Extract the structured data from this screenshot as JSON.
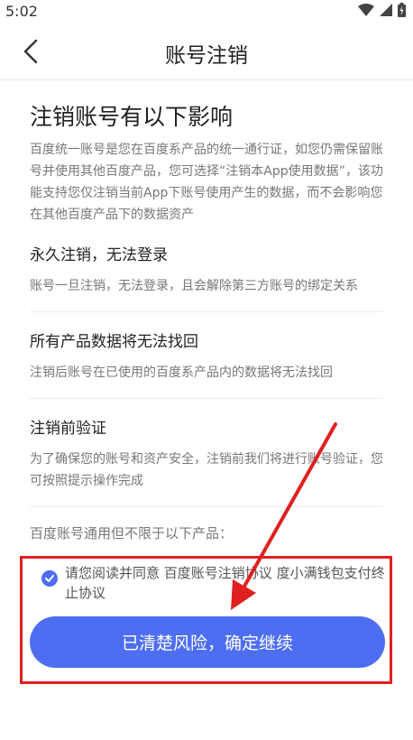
{
  "status_bar": {
    "time": "5:02",
    "icons": [
      "wifi-icon",
      "cellular-signal-icon",
      "battery-icon"
    ]
  },
  "header": {
    "title": "账号注销",
    "back_icon": "chevron-left-icon"
  },
  "main": {
    "heading": "注销账号有以下影响",
    "intro": "百度统一账号是您在百度系产品的统一通行证，如您仍需保留账号并使用其他百度产品，您可选择“注销本App使用数据”，该功能支持您仅注销当前App下账号使用产生的数据，而不会影响您在其他百度产品下的数据资产",
    "sections": [
      {
        "title": "永久注销，无法登录",
        "desc": "账号一旦注销，无法登录，且会解除第三方账号的绑定关系"
      },
      {
        "title": "所有产品数据将无法找回",
        "desc": "注销后账号在已使用的百度系产品内的数据将无法找回"
      },
      {
        "title": "注销前验证",
        "desc": "为了确保您的账号和资产安全，注销前我们将进行账号验证，您可按照提示操作完成"
      }
    ],
    "products_label": "百度账号通用但不限于以下产品："
  },
  "agreement": {
    "checked": true,
    "prefix": "请您阅读并同意 ",
    "link1": "百度账号注销协议",
    "link2": "度小满钱包支付终止协议"
  },
  "confirm_button": {
    "label": "已清楚风险，确定继续"
  },
  "colors": {
    "accent": "#4e6ef2",
    "annotation_red": "#e02020"
  }
}
